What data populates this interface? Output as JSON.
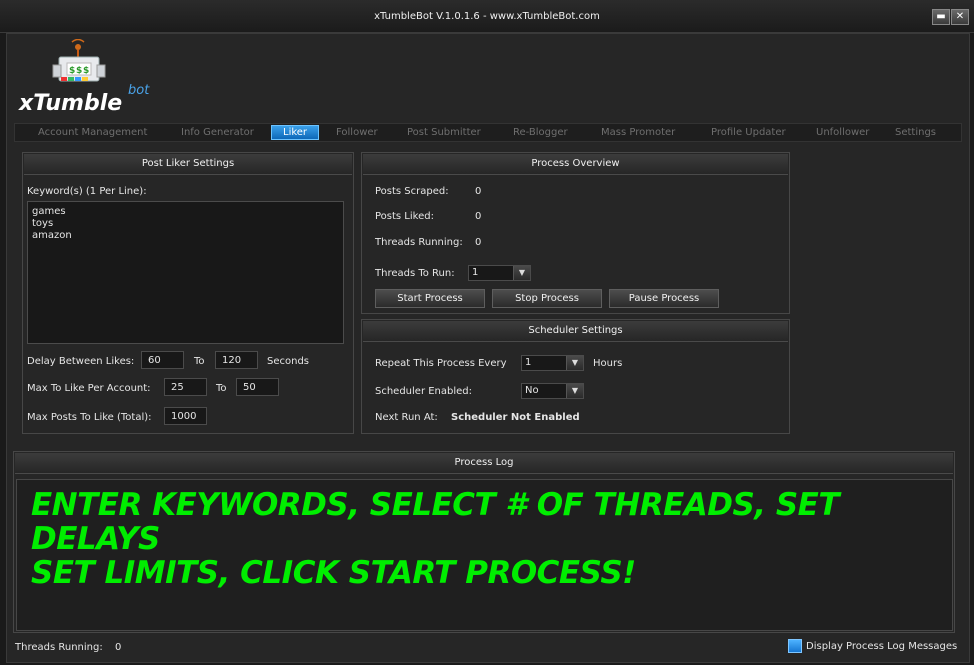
{
  "window": {
    "title": "xTumbleBot V.1.0.1.6 - www.xTumbleBot.com",
    "minimize": "▬",
    "close": "✕"
  },
  "logo": {
    "name": "xTumble",
    "suffix": "bot",
    "icon": "robot-dollar-icon"
  },
  "tabs": [
    {
      "label": "Account Management"
    },
    {
      "label": "Info Generator"
    },
    {
      "label": "Liker",
      "active": true
    },
    {
      "label": "Follower"
    },
    {
      "label": "Post Submitter"
    },
    {
      "label": "Re-Blogger"
    },
    {
      "label": "Mass Promoter"
    },
    {
      "label": "Profile Updater"
    },
    {
      "label": "Unfollower"
    },
    {
      "label": "Settings"
    }
  ],
  "liker": {
    "header": "Post Liker Settings",
    "keywords_label": "Keyword(s) (1 Per Line):",
    "keywords": [
      "games",
      "toys",
      "amazon"
    ],
    "delay_label": "Delay Between Likes:",
    "delay_from": "60",
    "delay_to_label": "To",
    "delay_to": "120",
    "delay_unit": "Seconds",
    "max_account_label": "Max To Like Per Account:",
    "max_account_from": "25",
    "max_account_to_label": "To",
    "max_account_to": "50",
    "max_total_label": "Max Posts To Like (Total):",
    "max_total": "1000"
  },
  "overview": {
    "header": "Process Overview",
    "posts_scraped_label": "Posts Scraped:",
    "posts_scraped": "0",
    "posts_liked_label": "Posts Liked:",
    "posts_liked": "0",
    "threads_running_label": "Threads Running:",
    "threads_running": "0",
    "threads_to_run_label": "Threads To Run:",
    "threads_to_run": "1",
    "start": "Start Process",
    "stop": "Stop Process",
    "pause": "Pause Process"
  },
  "scheduler": {
    "header": "Scheduler Settings",
    "repeat_label": "Repeat This Process Every",
    "repeat_value": "1",
    "repeat_unit": "Hours",
    "enabled_label": "Scheduler Enabled:",
    "enabled_value": "No",
    "next_run_label": "Next Run At:",
    "next_run_value": "Scheduler Not Enabled"
  },
  "log": {
    "header": "Process Log",
    "line1": "ENTER KEYWORDS, SELECT # OF THREADS, SET DELAYS",
    "line2": "SET LIMITS, CLICK START PROCESS!"
  },
  "status": {
    "threads_label": "Threads Running:",
    "threads_value": "0",
    "display_log_label": "Display Process Log Messages",
    "display_log_checked": true
  },
  "colors": {
    "accent": "#1f86d6",
    "log_text": "#00ee00",
    "background": "#262626"
  }
}
